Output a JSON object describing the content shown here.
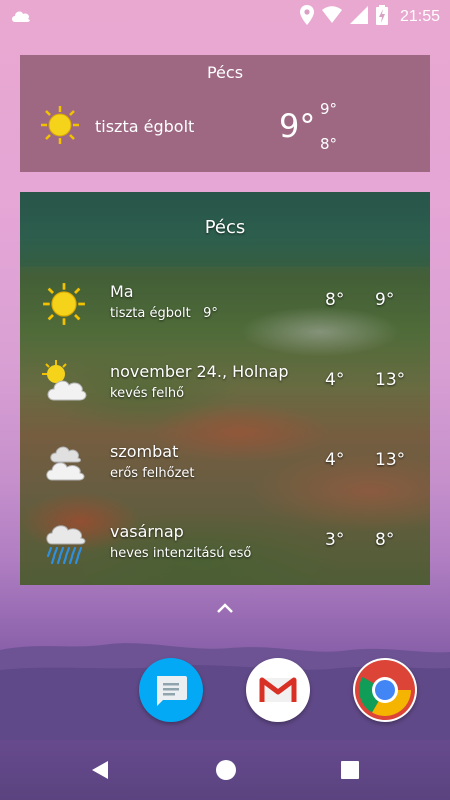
{
  "status_bar": {
    "time": "21:55",
    "icons": [
      "cloud-icon",
      "location-icon",
      "wifi-icon",
      "signal-icon",
      "battery-charging-icon"
    ]
  },
  "widget_current": {
    "city": "Pécs",
    "icon": "sun-icon",
    "description": "tiszta égbolt",
    "temperature": "9°",
    "high": "9°",
    "low": "8°"
  },
  "widget_forecast": {
    "city": "Pécs",
    "days": [
      {
        "day": "Ma",
        "condition": "tiszta égbolt",
        "current": "9°",
        "min": "8°",
        "max": "9°",
        "icon": "sun-icon"
      },
      {
        "day": "november 24., Holnap",
        "condition": "kevés felhő",
        "min": "4°",
        "max": "13°",
        "icon": "sun-cloud-icon"
      },
      {
        "day": "szombat",
        "condition": "erős felhőzet",
        "min": "4°",
        "max": "13°",
        "icon": "clouds-icon"
      },
      {
        "day": "vasárnap",
        "condition": "heves intenzitású eső",
        "min": "3°",
        "max": "8°",
        "icon": "rain-icon"
      }
    ]
  },
  "dock": {
    "apps": [
      "messages-app-icon",
      "gmail-app-icon",
      "chrome-app-icon"
    ],
    "colors": {
      "messages": "#039be5",
      "gmail_red": "#d93025",
      "chrome_red": "#db4437",
      "chrome_green": "#0f9d58",
      "chrome_yellow": "#f4b400",
      "chrome_blue": "#4285f4"
    }
  },
  "navbar": {
    "icons": [
      "back-icon",
      "home-icon",
      "recents-icon"
    ]
  }
}
